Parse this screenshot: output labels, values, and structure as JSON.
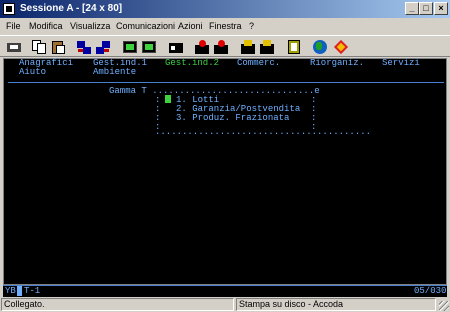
{
  "window": {
    "title": "Sessione A - [24 x 80]"
  },
  "menu": [
    {
      "label": "File"
    },
    {
      "label": "Modifica"
    },
    {
      "label": "Visualizza"
    },
    {
      "label": "Comunicazioni"
    },
    {
      "label": "Azioni"
    },
    {
      "label": "Finestra"
    },
    {
      "label": "?"
    }
  ],
  "toolbar": [
    {
      "icon": "print-screen-icon"
    },
    {
      "icon": "copy-icon"
    },
    {
      "icon": "paste-icon"
    },
    {
      "icon": "send-file-icon"
    },
    {
      "icon": "receive-file-icon"
    },
    {
      "icon": "display-icon"
    },
    {
      "icon": "color-map-icon"
    },
    {
      "icon": "macro-icon"
    },
    {
      "icon": "record-macro-icon"
    },
    {
      "icon": "play-macro-icon"
    },
    {
      "icon": "keyboard-map-icon"
    },
    {
      "icon": "session-icon"
    },
    {
      "icon": "clipboard-icon"
    },
    {
      "icon": "globe-icon"
    },
    {
      "icon": "help-icon"
    }
  ],
  "terminal": {
    "menu_line1": {
      "anagrafici": "Anagrafici",
      "gest1": "Gest.ind.1",
      "gest2": "Gest.ind.2",
      "commerc": "Commerc.",
      "riorganiz": "Riorganiz.",
      "servizi": "Servizi"
    },
    "menu_line2": {
      "aiuto": "Aiuto",
      "ambiente": "Ambiente"
    },
    "popup": {
      "top": "Gamma T ..............................e",
      "items": [
        "1. Lotti",
        "2. Garanzia/Postvendita",
        "3. Produz. Frazionata"
      ],
      "dot": ":",
      "bottom": "........................................"
    },
    "status_left": "YB",
    "status_field": "T-1",
    "status_right": "05/030",
    "colors": {
      "blue": "#70b0ff",
      "green": "#3fd23f",
      "background": "#000000"
    }
  },
  "statusbar": {
    "left": "Collegato.",
    "mid": "Stampa su disco - Accoda"
  }
}
